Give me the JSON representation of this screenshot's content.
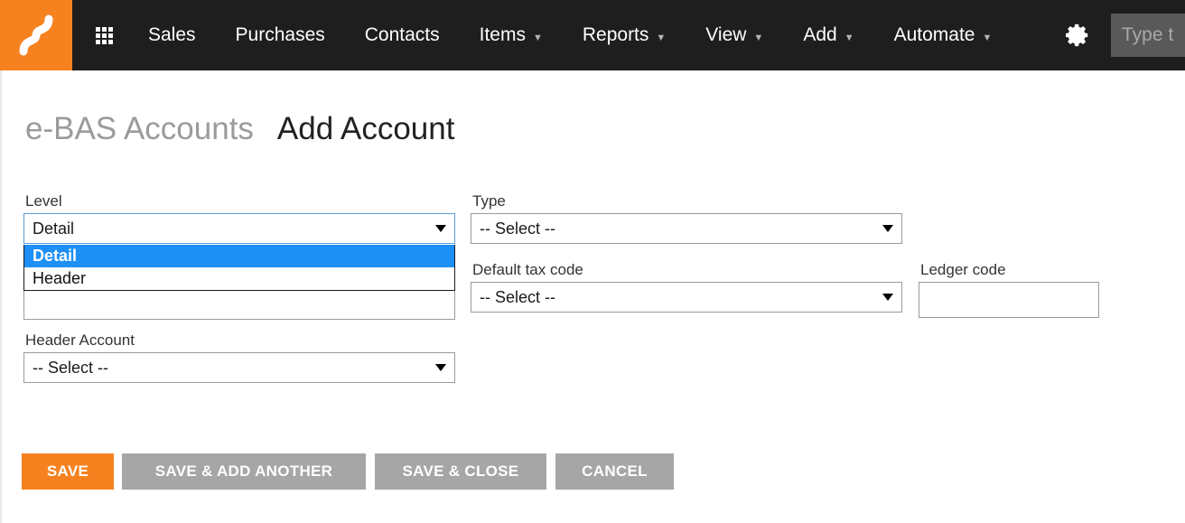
{
  "navbar": {
    "logo_name": "saasu-logo",
    "apps_icon": "grid-apps-icon",
    "items": [
      {
        "label": "Sales",
        "caret": false
      },
      {
        "label": "Purchases",
        "caret": false
      },
      {
        "label": "Contacts",
        "caret": false
      },
      {
        "label": "Items",
        "caret": true
      },
      {
        "label": "Reports",
        "caret": true
      },
      {
        "label": "View",
        "caret": true
      },
      {
        "label": "Add",
        "caret": true
      },
      {
        "label": "Automate",
        "caret": true
      }
    ],
    "caret_glyph": "▼",
    "settings_icon": "gear-icon",
    "search": {
      "value": "",
      "placeholder": "Type t"
    }
  },
  "header": {
    "breadcrumb": "e-BAS Accounts",
    "title": "Add Account"
  },
  "form": {
    "level": {
      "label": "Level",
      "value": "Detail",
      "options": [
        "Detail",
        "Header"
      ],
      "selected_index": 0,
      "open": true
    },
    "type": {
      "label": "Type",
      "value": "-- Select --"
    },
    "default_tax_code": {
      "label": "Default tax code",
      "value": "-- Select --"
    },
    "ledger_code": {
      "label": "Ledger code",
      "value": ""
    },
    "obscured_text_field": {
      "value": ""
    },
    "header_account": {
      "label": "Header Account",
      "value": "-- Select --"
    }
  },
  "actions": {
    "save": "SAVE",
    "save_add_another": "SAVE & ADD ANOTHER",
    "save_close": "SAVE & CLOSE",
    "cancel": "CANCEL"
  },
  "colors": {
    "brand_orange": "#f5821f",
    "navbar_dark": "#1e1e1e",
    "secondary_gray": "#a6a6a6",
    "highlight_blue": "#1e90f5",
    "focus_blue": "#5b9bd5"
  }
}
